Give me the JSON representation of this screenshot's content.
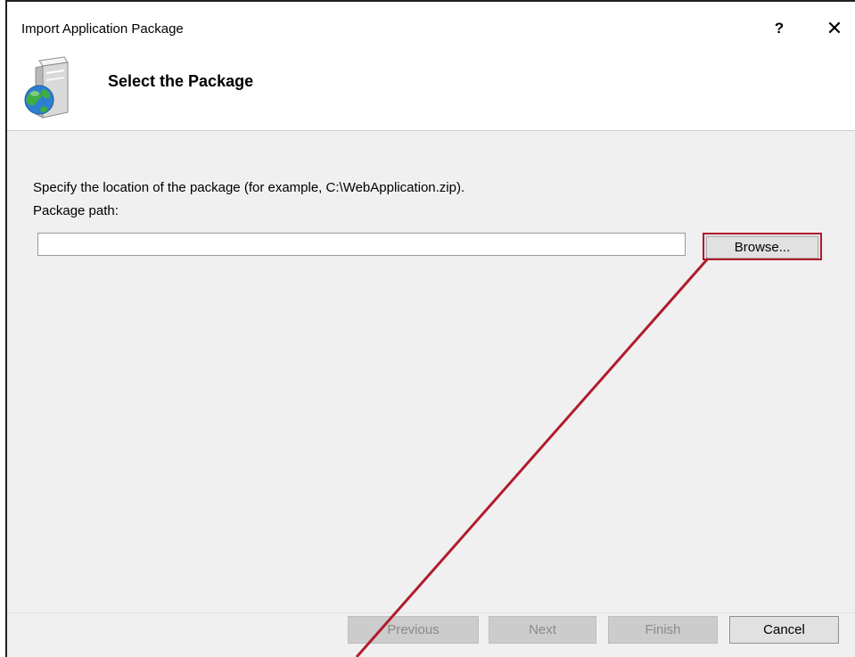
{
  "window": {
    "title": "Import Application Package",
    "help_glyph": "?",
    "close_glyph": "✕"
  },
  "header": {
    "title": "Select the Package",
    "icon": "package-globe-icon"
  },
  "content": {
    "description": "Specify the location of the package (for example, C:\\WebApplication.zip).",
    "path_label": "Package path:",
    "path_value": "",
    "browse_label": "Browse..."
  },
  "footer": {
    "previous_label": "Previous",
    "next_label": "Next",
    "finish_label": "Finish",
    "cancel_label": "Cancel"
  },
  "colors": {
    "highlight": "#b01c2e",
    "content_bg": "#f0f0f0",
    "disabled_button_bg": "#cccccc",
    "button_bg": "#e1e1e1"
  }
}
